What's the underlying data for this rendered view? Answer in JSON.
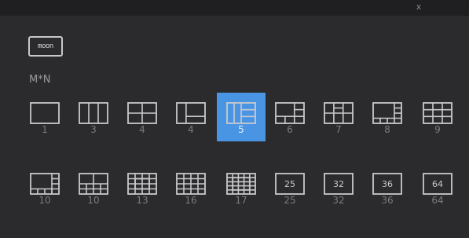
{
  "topbar": {
    "close_label": "x"
  },
  "mode_button": {
    "label": "moon"
  },
  "section": {
    "label": "M*N"
  },
  "layouts": {
    "row1": [
      {
        "label": "1",
        "icon": "layout-1-icon"
      },
      {
        "label": "3",
        "icon": "layout-3-icon"
      },
      {
        "label": "4",
        "icon": "layout-4-icon"
      },
      {
        "label": "4",
        "icon": "layout-4b-icon"
      },
      {
        "label": "5",
        "icon": "layout-5-icon",
        "selected": true
      },
      {
        "label": "6",
        "icon": "layout-6-icon"
      },
      {
        "label": "7",
        "icon": "layout-7-icon"
      },
      {
        "label": "8",
        "icon": "layout-8-icon"
      },
      {
        "label": "9",
        "icon": "layout-9-icon"
      }
    ],
    "row2": [
      {
        "label": "10",
        "icon": "layout-10-icon"
      },
      {
        "label": "10",
        "icon": "layout-10b-icon"
      },
      {
        "label": "13",
        "icon": "layout-13-icon"
      },
      {
        "label": "16",
        "icon": "layout-16-icon"
      },
      {
        "label": "17",
        "icon": "layout-17-icon"
      },
      {
        "label": "25",
        "icon": "layout-25-icon",
        "badge": "25"
      },
      {
        "label": "32",
        "icon": "layout-32-icon",
        "badge": "32"
      },
      {
        "label": "36",
        "icon": "layout-36-icon",
        "badge": "36"
      },
      {
        "label": "64",
        "icon": "layout-64-icon",
        "badge": "64"
      }
    ]
  },
  "colors": {
    "background": "#2b2b2d",
    "selected": "#4a95e3",
    "icon_stroke": "#c9c9cd",
    "label_text": "#7c7c80"
  }
}
